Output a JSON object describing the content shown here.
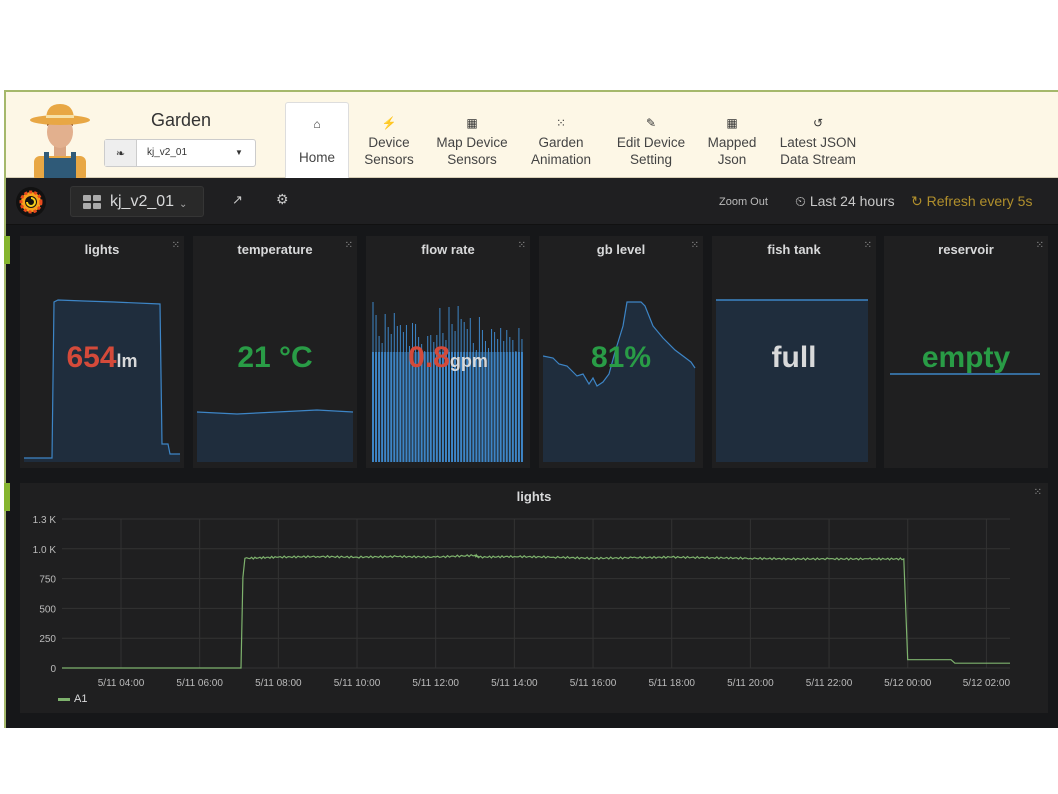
{
  "topnav": {
    "brand_title": "Garden",
    "device_select": {
      "icon": "leaf-icon",
      "value": "kj_v2_01"
    },
    "tabs": [
      {
        "id": "home",
        "icon": "home-icon",
        "glyph": "⌂",
        "line1": "",
        "line2": "Home",
        "active": true
      },
      {
        "id": "device-sensors",
        "icon": "plug-icon",
        "glyph": "⚡",
        "line1": "Device",
        "line2": "Sensors",
        "active": false
      },
      {
        "id": "map-device-sensors",
        "icon": "map-icon",
        "glyph": "▦",
        "line1": "Map Device",
        "line2": "Sensors",
        "active": false
      },
      {
        "id": "garden-animation",
        "icon": "spinner-icon",
        "glyph": "⁙",
        "line1": "Garden",
        "line2": "Animation",
        "active": false
      },
      {
        "id": "edit-device-setting",
        "icon": "pencil-icon",
        "glyph": "✎",
        "line1": "Edit Device",
        "line2": "Setting",
        "active": false
      },
      {
        "id": "mapped-json",
        "icon": "map-icon",
        "glyph": "▦",
        "line1": "Mapped",
        "line2": "Json",
        "active": false
      },
      {
        "id": "latest-json",
        "icon": "history-icon",
        "glyph": "↺",
        "line1": "Latest JSON",
        "line2": "Data Stream",
        "active": false
      }
    ]
  },
  "dashbar": {
    "dashboard_name": "kj_v2_01",
    "zoom_out": "Zoom Out",
    "time_range": "Last 24 hours",
    "refresh": "Refresh every 5s",
    "clock_glyph": "⏲",
    "refresh_glyph": "↻",
    "share_glyph": "↗",
    "gear_glyph": "⚙",
    "caret_glyph": "⌄"
  },
  "stats": [
    {
      "id": "lights",
      "title": "lights",
      "value": "654",
      "unit": "lm",
      "color": "#d44a3a",
      "spark": "lights"
    },
    {
      "id": "temperature",
      "title": "temperature",
      "value": "21 °C",
      "unit": "",
      "color": "#299c46",
      "spark": "temperature"
    },
    {
      "id": "flow-rate",
      "title": "flow rate",
      "value": "0.8",
      "unit": "gpm",
      "color": "#d44a3a",
      "spark": "flow"
    },
    {
      "id": "gb-level",
      "title": "gb level",
      "value": "81%",
      "unit": "",
      "color": "#299c46",
      "spark": "gb"
    },
    {
      "id": "fish-tank",
      "title": "fish tank",
      "value": "full",
      "unit": "",
      "color": "#d8d9da",
      "spark": "full"
    },
    {
      "id": "reservoir",
      "title": "reservoir",
      "value": "empty",
      "unit": "",
      "color": "#299c46",
      "spark": "empty"
    }
  ],
  "chart_data": {
    "type": "line",
    "title": "lights",
    "xlabel": "",
    "ylabel": "",
    "x_ticks": [
      "5/11 04:00",
      "5/11 06:00",
      "5/11 08:00",
      "5/11 10:00",
      "5/11 12:00",
      "5/11 14:00",
      "5/11 16:00",
      "5/11 18:00",
      "5/11 20:00",
      "5/11 22:00",
      "5/12 00:00",
      "5/12 02:00"
    ],
    "x_range_hours": [
      2.5,
      26.6
    ],
    "y_ticks": [
      "0",
      "250",
      "500",
      "750",
      "1.0 K",
      "1.3 K"
    ],
    "y_tick_values": [
      0,
      250,
      500,
      750,
      1000,
      1250
    ],
    "ylim": [
      0,
      1250
    ],
    "grid": true,
    "legend": "bottom-left",
    "series": [
      {
        "name": "A1",
        "color": "#7eb26d",
        "points_hours_values": [
          [
            2.5,
            0
          ],
          [
            7.0,
            0
          ],
          [
            7.05,
            0
          ],
          [
            7.1,
            760
          ],
          [
            7.15,
            920
          ],
          [
            8.0,
            930
          ],
          [
            9.0,
            935
          ],
          [
            10.0,
            930
          ],
          [
            11.0,
            935
          ],
          [
            12.0,
            930
          ],
          [
            13.0,
            945
          ],
          [
            13.1,
            930
          ],
          [
            14.0,
            935
          ],
          [
            15.0,
            930
          ],
          [
            16.0,
            920
          ],
          [
            17.0,
            925
          ],
          [
            18.0,
            930
          ],
          [
            19.0,
            925
          ],
          [
            20.0,
            920
          ],
          [
            21.0,
            915
          ],
          [
            22.0,
            915
          ],
          [
            23.0,
            915
          ],
          [
            23.9,
            915
          ],
          [
            24.0,
            70
          ],
          [
            25.1,
            70
          ],
          [
            25.2,
            40
          ],
          [
            26.6,
            40
          ]
        ]
      }
    ]
  }
}
